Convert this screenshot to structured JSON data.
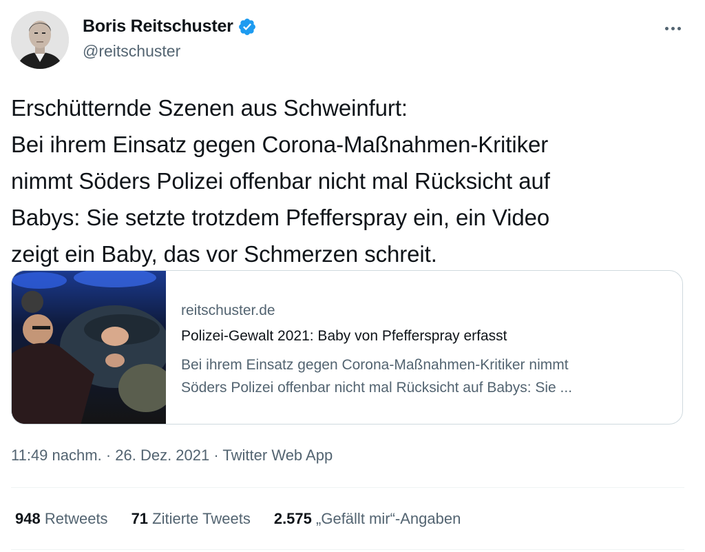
{
  "author": {
    "display_name": "Boris Reitschuster",
    "handle": "@reitschuster",
    "verified": true,
    "verified_color": "#1d9bf0",
    "avatar_icon": "profile-photo"
  },
  "tweet": {
    "lines": [
      "Erschütternde Szenen aus Schweinfurt:",
      "Bei ihrem Einsatz gegen Corona-Maßnahmen-Kritiker",
      "nimmt Söders Polizei offenbar nicht mal Rücksicht auf",
      "Babys: Sie setzte trotzdem Pfefferspray ein, ein Video",
      "zeigt ein Baby, das vor Schmerzen schreit."
    ]
  },
  "card": {
    "domain": "reitschuster.de",
    "title": "Polizei-Gewalt 2021: Baby von Pfefferspray erfasst",
    "description_lines": [
      "Bei ihrem Einsatz gegen Corona-Maßnahmen-Kritiker nimmt",
      "Söders Polizei offenbar nicht mal Rücksicht auf Babys: Sie ..."
    ]
  },
  "meta": {
    "time": "11:49 nachm.",
    "separator": "·",
    "date": "26. Dez. 2021",
    "source": "Twitter Web App"
  },
  "stats": {
    "retweets_count": "948",
    "retweets_label": "Retweets",
    "quotes_count": "71",
    "quotes_label": "Zitierte Tweets",
    "likes_count": "2.575",
    "likes_label": "„Gefällt mir“-Angaben"
  },
  "colors": {
    "text_primary": "#0f1419",
    "text_secondary": "#536471",
    "border": "#cfd9de",
    "divider": "#eff3f4"
  }
}
